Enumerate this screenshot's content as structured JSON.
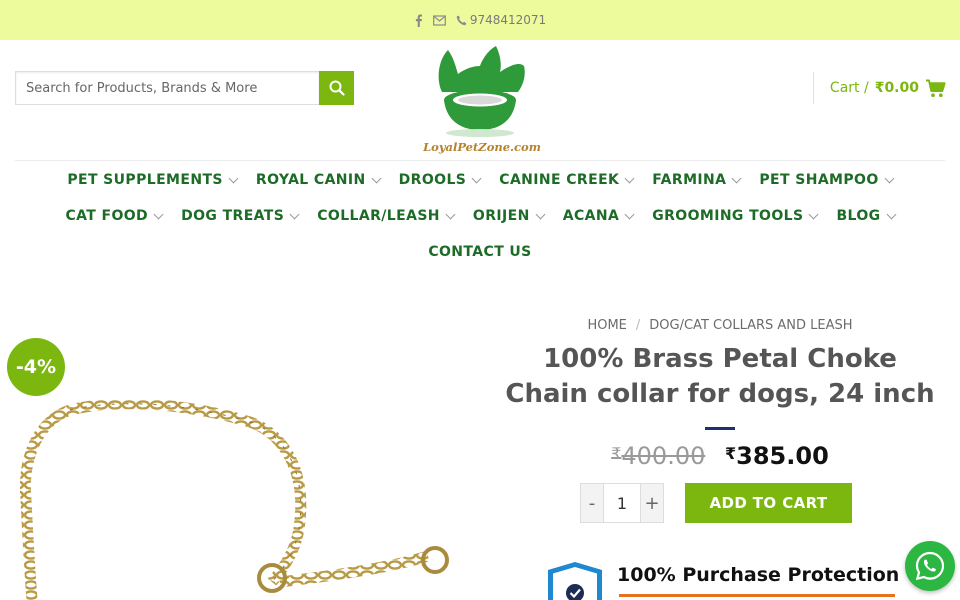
{
  "topbar": {
    "phone": "9748412071",
    "icons": [
      "facebook-icon",
      "mail-icon",
      "phone-icon"
    ]
  },
  "search": {
    "placeholder": "Search for Products, Brands & More"
  },
  "logo": {
    "text": "LoyalPetZone.com"
  },
  "cart": {
    "label": "Cart /",
    "amount": "₹0.00"
  },
  "nav": {
    "row1": [
      "PET SUPPLEMENTS",
      "ROYAL CANIN",
      "DROOLS",
      "CANINE CREEK",
      "FARMINA",
      "PET SHAMPOO"
    ],
    "row2": [
      "CAT FOOD",
      "DOG TREATS",
      "COLLAR/LEASH",
      "ORIJEN",
      "ACANA",
      "GROOMING TOOLS",
      "BLOG"
    ],
    "row3": [
      "CONTACT US"
    ]
  },
  "product": {
    "badge": "-4%",
    "breadcrumb": [
      "HOME",
      "DOG/CAT COLLARS AND LEASH"
    ],
    "breadcrumb_sep": "/",
    "title_line1": "100% Brass Petal Choke",
    "title_line2": "Chain collar for dogs, 24 inch",
    "currency": "₹",
    "old_price": "400.00",
    "new_price": "385.00",
    "qty_minus": "-",
    "qty_value": "1",
    "qty_plus": "+",
    "add_to_cart": "ADD TO CART"
  },
  "protection": {
    "text": "100% Purchase Protection"
  },
  "colors": {
    "accent": "#7cb70f",
    "topbar_bg": "#eefb9c",
    "nav_text": "#1c6b26",
    "title_divider": "#1d3170",
    "whatsapp": "#2bb741"
  }
}
